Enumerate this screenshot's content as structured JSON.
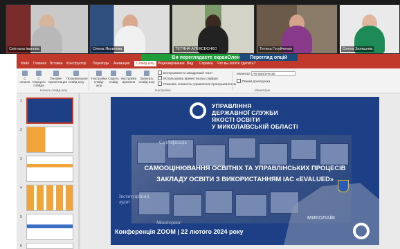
{
  "participants": [
    {
      "name": "Світлана Іванова"
    },
    {
      "name": "Олена Яковлева"
    },
    {
      "name": "ТЕТЯНА АЛЕКСЕЄНКО"
    },
    {
      "name": "Тетяна Гогуйченко"
    },
    {
      "name": "Олена Запишняк"
    }
  ],
  "zoom": {
    "share_banner": "Ви переглядаєте екранОлена Яковлєва",
    "view_options": "Перегляд опцій"
  },
  "ppt": {
    "tabs": [
      "Файл",
      "Главная",
      "Вставка",
      "Конструктор",
      "Переходы",
      "Анимация",
      "Слайд-шоу",
      "Рецензирование",
      "Вид",
      "Справка",
      "Что вы хотите сделать?"
    ],
    "active_tab": "Слайд-шоу",
    "ribbon": {
      "buttons": [
        "С начала",
        "С текущего слайда",
        "Онлайн-презентация",
        "Произвольное слайд-шоу",
        "Настройка слайд-шоу",
        "Скрыть слайд",
        "Настройка времени",
        "Записать слайд-шоу"
      ],
      "checkboxes": [
        "Воспроизвести закадровый текст",
        "Использовать время показа слайдов",
        "Показать элементы управления проигрывателем"
      ],
      "monitor_label": "Монитор:",
      "monitor_value": "Автоматически",
      "presenter_mode": "Режим докладчика",
      "groups": [
        "Начать слайд-шоу",
        "Настройка",
        "Мониторы"
      ]
    },
    "slide_numbers": [
      "1",
      "2",
      "3",
      "4",
      "5",
      "6"
    ]
  },
  "slide": {
    "org_lines": [
      "УПРАВЛІННЯ",
      "ДЕРЖАВНОЇ СЛУЖБИ",
      "ЯКОСТІ ОСВІТИ",
      "У МИКОЛАЇВСЬКІЙ ОБЛАСТІ"
    ],
    "title_lines": [
      "САМООЦІНЮВАННЯ ОСВІТНІХ ТА УПРАВЛІНСЬКИХ ПРОЦЕСІВ",
      "ЗАКЛАДУ ОСВІТИ З ВИКОРИСТАННЯМ ІАС «EVALUED»"
    ],
    "conference": "Конференція ZOOM | 22 лютого 2024 року",
    "overlay_words": [
      "Сертифікація",
      "Інституційний аудит",
      "Моніторинг",
      "МИКОЛАЇВ"
    ]
  },
  "colors": {
    "ppt_accent": "#c0392b",
    "zoom_green": "#1f9d3a",
    "slide_blue": "#1c3f86"
  }
}
